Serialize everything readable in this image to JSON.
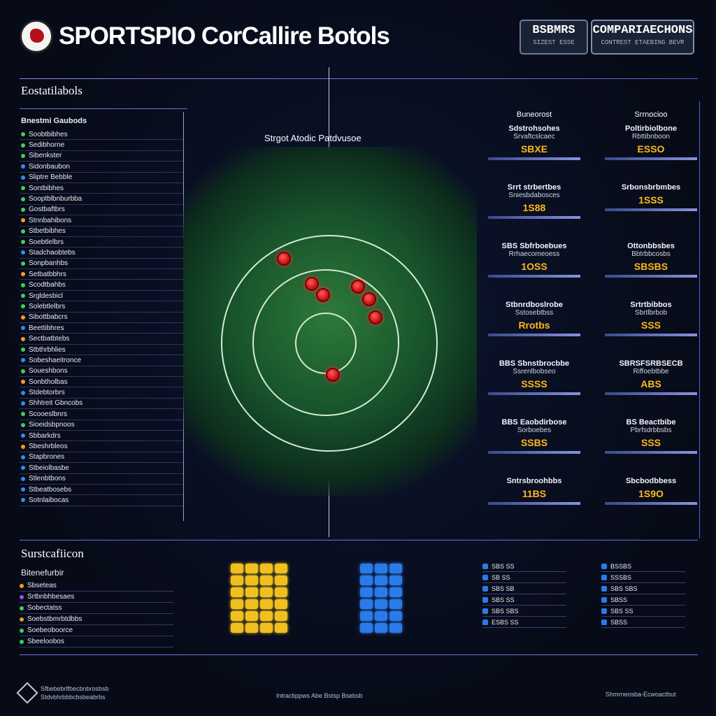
{
  "header": {
    "app_title": "SPORTSPIO CorCallire Botols",
    "logo_icon": "soccer-ball-icon",
    "button_a": {
      "label": "BSBMRS",
      "sub": "SIZEST ESSE"
    },
    "button_b": {
      "label": "COMPARIAECHONS",
      "sub": "CONTREST ETAEBING BEVR"
    }
  },
  "left_panel": {
    "title": "Eostatilabols",
    "header": "Bnestmi Gaubods",
    "items": [
      {
        "label": "Soobtbibhes",
        "color": "#3fcf5a"
      },
      {
        "label": "Sedibhorne",
        "color": "#3fcf5a"
      },
      {
        "label": "Sibenkster",
        "color": "#3fcf5a"
      },
      {
        "label": "Sidonbaubon",
        "color": "#2d8dff"
      },
      {
        "label": "Sliptre Bebble",
        "color": "#2d8dff"
      },
      {
        "label": "Sontbibhes",
        "color": "#3fcf5a"
      },
      {
        "label": "Sooptblbnburbba",
        "color": "#3fcf5a"
      },
      {
        "label": "Gostbaftbrs",
        "color": "#3fcf5a"
      },
      {
        "label": "Stnnbahibons",
        "color": "#ff9a1f"
      },
      {
        "label": "Stbetbibhes",
        "color": "#3fcf5a"
      },
      {
        "label": "Soebtlelbrs",
        "color": "#3fcf5a"
      },
      {
        "label": "Stadchaobtebs",
        "color": "#2d8dff"
      },
      {
        "label": "Sonpbanhbs",
        "color": "#3fcf5a"
      },
      {
        "label": "Setbatbbhrs",
        "color": "#ff9a1f"
      },
      {
        "label": "Scodtbahbs",
        "color": "#3fcf5a"
      },
      {
        "label": "Srgldesbicl",
        "color": "#3fcf5a"
      },
      {
        "label": "Solebtlelbrs",
        "color": "#3fcf5a"
      },
      {
        "label": "Sibottbabcrs",
        "color": "#ff9a1f"
      },
      {
        "label": "Beettibhres",
        "color": "#2d8dff"
      },
      {
        "label": "Sectbatbtebs",
        "color": "#ff9a1f"
      },
      {
        "label": "Stbthrbhlies",
        "color": "#3fcf5a"
      },
      {
        "label": "Sobeshaeitronce",
        "color": "#2d8dff"
      },
      {
        "label": "Soueshbons",
        "color": "#3fcf5a"
      },
      {
        "label": "Sonbtholbas",
        "color": "#ff9a1f"
      },
      {
        "label": "Stdebtorbrs",
        "color": "#2d8dff"
      },
      {
        "label": "Shhtreit Gbncobs",
        "color": "#2d8dff"
      },
      {
        "label": "Scooeslbnrs",
        "color": "#3fcf5a"
      },
      {
        "label": "Sioeidsbpnoos",
        "color": "#3fcf5a"
      },
      {
        "label": "Sbbarkdrs",
        "color": "#2d8dff"
      },
      {
        "label": "Sbeshrbleos",
        "color": "#ff9a1f"
      },
      {
        "label": "Stapbrones",
        "color": "#2d8dff"
      },
      {
        "label": "Stbeiolbasbe",
        "color": "#2d8dff"
      },
      {
        "label": "Stlenbtbons",
        "color": "#2d8dff"
      },
      {
        "label": "Stbeatbosebs",
        "color": "#2d8dff"
      },
      {
        "label": "Sotnlaibocas",
        "color": "#2d8dff"
      }
    ]
  },
  "pitch": {
    "title": "Strgot Atodic Patdvusoe"
  },
  "cards_left": {
    "header": "Buneorost",
    "cards": [
      {
        "title": "Sdstrohsohes",
        "sub": "Srvaftcslcaec",
        "value": "SBXE"
      },
      {
        "title": "Srrt strbertbes",
        "sub": "Sniesbdabosces",
        "value": "1S88"
      },
      {
        "title": "SBS Sbfrboebues",
        "sub": "Rrhaecomeoess",
        "value": "1OSS"
      },
      {
        "title": "Stbnrdboslrobe",
        "sub": "Sstosebtbss",
        "value": "Rrotbs"
      },
      {
        "title": "BBS Sbnstbrocbbe",
        "sub": "Ssrenlbobseo",
        "value": "SSSS"
      },
      {
        "title": "BBS Eaobdirbose",
        "sub": "Sorboebes",
        "value": "SSBS"
      },
      {
        "title": "Sntrsbroohbbs",
        "sub": "",
        "value": "11BS"
      }
    ]
  },
  "cards_right": {
    "header": "Srrnocioo",
    "cards": [
      {
        "title": "Poltirbiolbone",
        "sub": "Rbttibnboon",
        "value": "ESSO"
      },
      {
        "title": "Srbonsbrbmbes",
        "sub": "",
        "value": "1SSS"
      },
      {
        "title": "Ottonbbsbes",
        "sub": "Bbtrbbcosbs",
        "value": "SBSBS"
      },
      {
        "title": "Srtrtbibbos",
        "sub": "Sbrtlbrbob",
        "value": "SSS"
      },
      {
        "title": "SBRSFSRBSECB",
        "sub": "Riffoebtbbe",
        "value": "ABS"
      },
      {
        "title": "BS Beactbibe",
        "sub": "Pbrfsdrbbsbs",
        "value": "SSS"
      },
      {
        "title": "Sbcbodbbess",
        "sub": "",
        "value": "1S9O"
      }
    ]
  },
  "substats": {
    "title": "Surstcafiicon",
    "header": "Bitenefurbir",
    "items": [
      {
        "label": "Sbseteas",
        "color": "#ff9a1f"
      },
      {
        "label": "Srtbnbhbesaes",
        "color": "#a14cff"
      },
      {
        "label": "Sobectatss",
        "color": "#3fcf5a"
      },
      {
        "label": "Soebstbmrbtdbbs",
        "color": "#ff9a1f"
      },
      {
        "label": "Soebeoboorce",
        "color": "#3fcf5a"
      },
      {
        "label": "Sbeeloobos",
        "color": "#3fcf5a"
      }
    ],
    "grid_color_yellow": "#f0c020",
    "grid_color_blue": "#2a7be8",
    "list_a": [
      "SBS SS",
      "SB SS",
      "SBS SB",
      "SBS SS",
      "SBS SBS",
      "ESBS SS"
    ],
    "list_b": [
      "BSSBS",
      "SSSBS",
      "SBS SBS",
      "SBSS",
      "SBS SS",
      "SBSS"
    ]
  },
  "footer": {
    "left_line1": "Sfbebebrlfbecbnbrosbsb",
    "left_line2": "Stdvbhrbbbcbsbeabrbs",
    "center": "Intractippws Abe Bstsp Bsebsb",
    "right": "Shmrneosba-Ecwoactbut"
  }
}
